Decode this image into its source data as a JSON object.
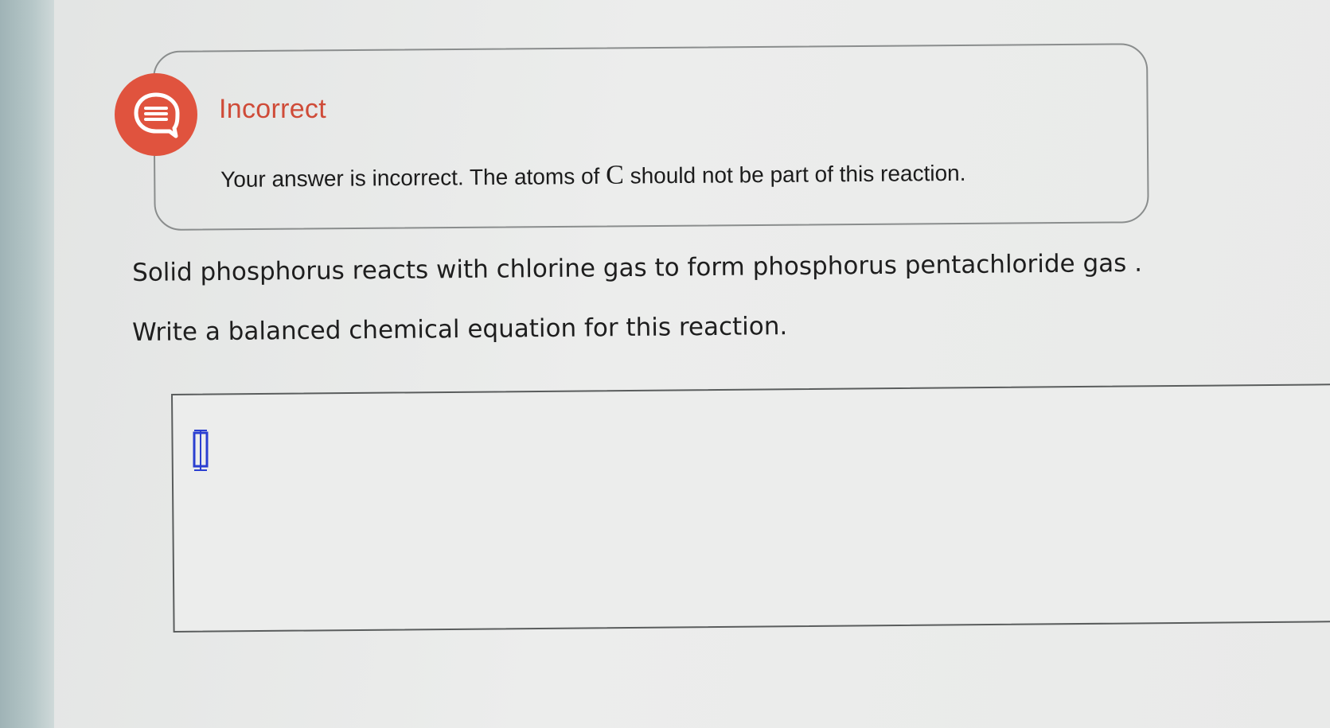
{
  "feedback": {
    "title": "Incorrect",
    "message_before": "Your answer is incorrect. The atoms of ",
    "element_symbol": "C",
    "message_after": " should not be part of this reaction.",
    "icon": "speech-bubble-icon",
    "accent_color": "#e0533e"
  },
  "question": {
    "line1": "Solid phosphorus reacts with chlorine gas to form phosphorus pentachloride gas .",
    "line2": "Write a balanced chemical equation for this reaction."
  },
  "answer": {
    "value": "",
    "cursor_icon": "formula-cursor-icon"
  }
}
